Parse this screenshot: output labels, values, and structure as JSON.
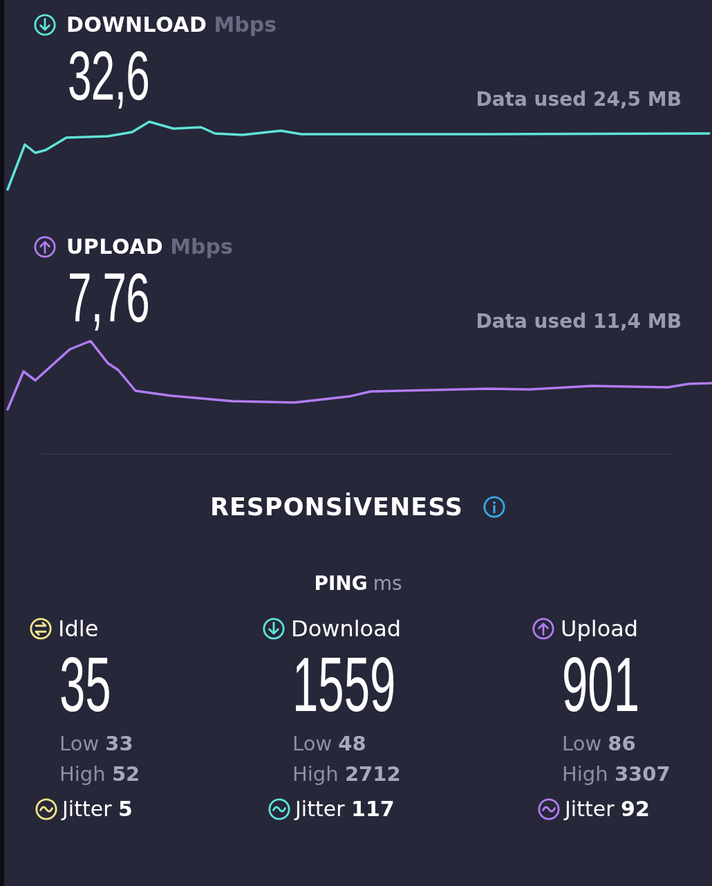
{
  "speeds": [
    {
      "kind": "download",
      "color": "#5fe3d8",
      "label": "DOWNLOAD",
      "unit": "Mbps",
      "value": "32,6",
      "data_used": "Data used 24,5 MB"
    },
    {
      "kind": "upload",
      "color": "#b27cf2",
      "label": "UPLOAD",
      "unit": "Mbps",
      "value": "7,76",
      "data_used": "Data used 11,4 MB"
    }
  ],
  "responsiveness": {
    "title": "RESPONSİVENESS",
    "ping_label": "PING",
    "ping_unit": "ms"
  },
  "ping": [
    {
      "kind": "idle",
      "color": "#f4e58a",
      "label": "Idle",
      "value": "35",
      "low_label": "Low",
      "low": "33",
      "high_label": "High",
      "high": "52",
      "jitter_label": "Jitter",
      "jitter": "5"
    },
    {
      "kind": "download",
      "color": "#5fe3d8",
      "label": "Download",
      "value": "1559",
      "low_label": "Low",
      "low": "48",
      "high_label": "High",
      "high": "2712",
      "jitter_label": "Jitter",
      "jitter": "117"
    },
    {
      "kind": "upload",
      "color": "#b27cf2",
      "label": "Upload",
      "value": "901",
      "low_label": "Low",
      "low": "86",
      "high_label": "High",
      "high": "3307",
      "jitter_label": "Jitter",
      "jitter": "92"
    }
  ]
}
